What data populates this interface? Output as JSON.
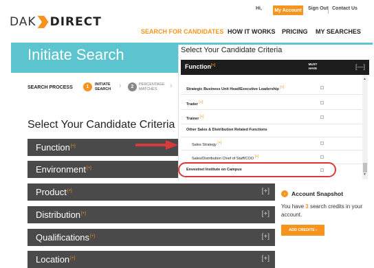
{
  "brand": {
    "logo_left": "DAK",
    "logo_right": "DIRECT"
  },
  "topbar": {
    "greeting": "Hi,",
    "my_account": "My Account",
    "sign_out": "Sign Out",
    "contact_us": "Contact Us"
  },
  "nav": [
    {
      "label": "SEARCH FOR CANDIDATES",
      "active": true
    },
    {
      "label": "HOW IT WORKS",
      "active": false
    },
    {
      "label": "PRICING",
      "active": false
    },
    {
      "label": "MY SEARCHES",
      "active": false
    }
  ],
  "banner": {
    "title": "Initiate Search"
  },
  "steps": {
    "label": "SEARCH PROCESS",
    "items": [
      {
        "number": "1",
        "text": "INITIATE SEARCH"
      },
      {
        "number": "2",
        "text": "PERCENTAGE MATCHES"
      }
    ],
    "arrow": "›"
  },
  "criteria": {
    "title": "Select Your Candidate Criteria",
    "star": "[+]",
    "expand": "[+]",
    "rows": [
      {
        "label": "Function"
      },
      {
        "label": "Environment"
      },
      {
        "label": "Product"
      },
      {
        "label": "Distribution"
      },
      {
        "label": "Qualifications"
      },
      {
        "label": "Location"
      }
    ]
  },
  "panel": {
    "title": "Select Your Candidate Criteria",
    "header": {
      "label": "Function",
      "star": "[+]",
      "must_have": "MUST HAVE",
      "collapse": "[—]"
    },
    "options": [
      {
        "text": "Strategic Business Unit Head/Executive Leadership",
        "star": "[+]"
      },
      {
        "text": "Trader",
        "star": "[+]"
      },
      {
        "text": "Trainer",
        "star": "[+]"
      },
      {
        "text": "Other Sales & Distribution Related Functions",
        "star": ""
      },
      {
        "text": "Sales Strategy",
        "star": "[+]"
      },
      {
        "text": "Sales/Distribution Chief of Staff/COO",
        "star": "[+]"
      },
      {
        "text": "Envestnet Institute on Campus",
        "star": ""
      }
    ]
  },
  "snapshot": {
    "title": "Account Snapshot",
    "text_before": "You have ",
    "credits": "3",
    "text_after": " search credits in your account.",
    "button": "ADD CREDITS  ›"
  },
  "colors": {
    "accent": "#f7941d",
    "teal": "#5bc4ce",
    "row": "#4a4a4a",
    "highlight": "#d9393b"
  }
}
